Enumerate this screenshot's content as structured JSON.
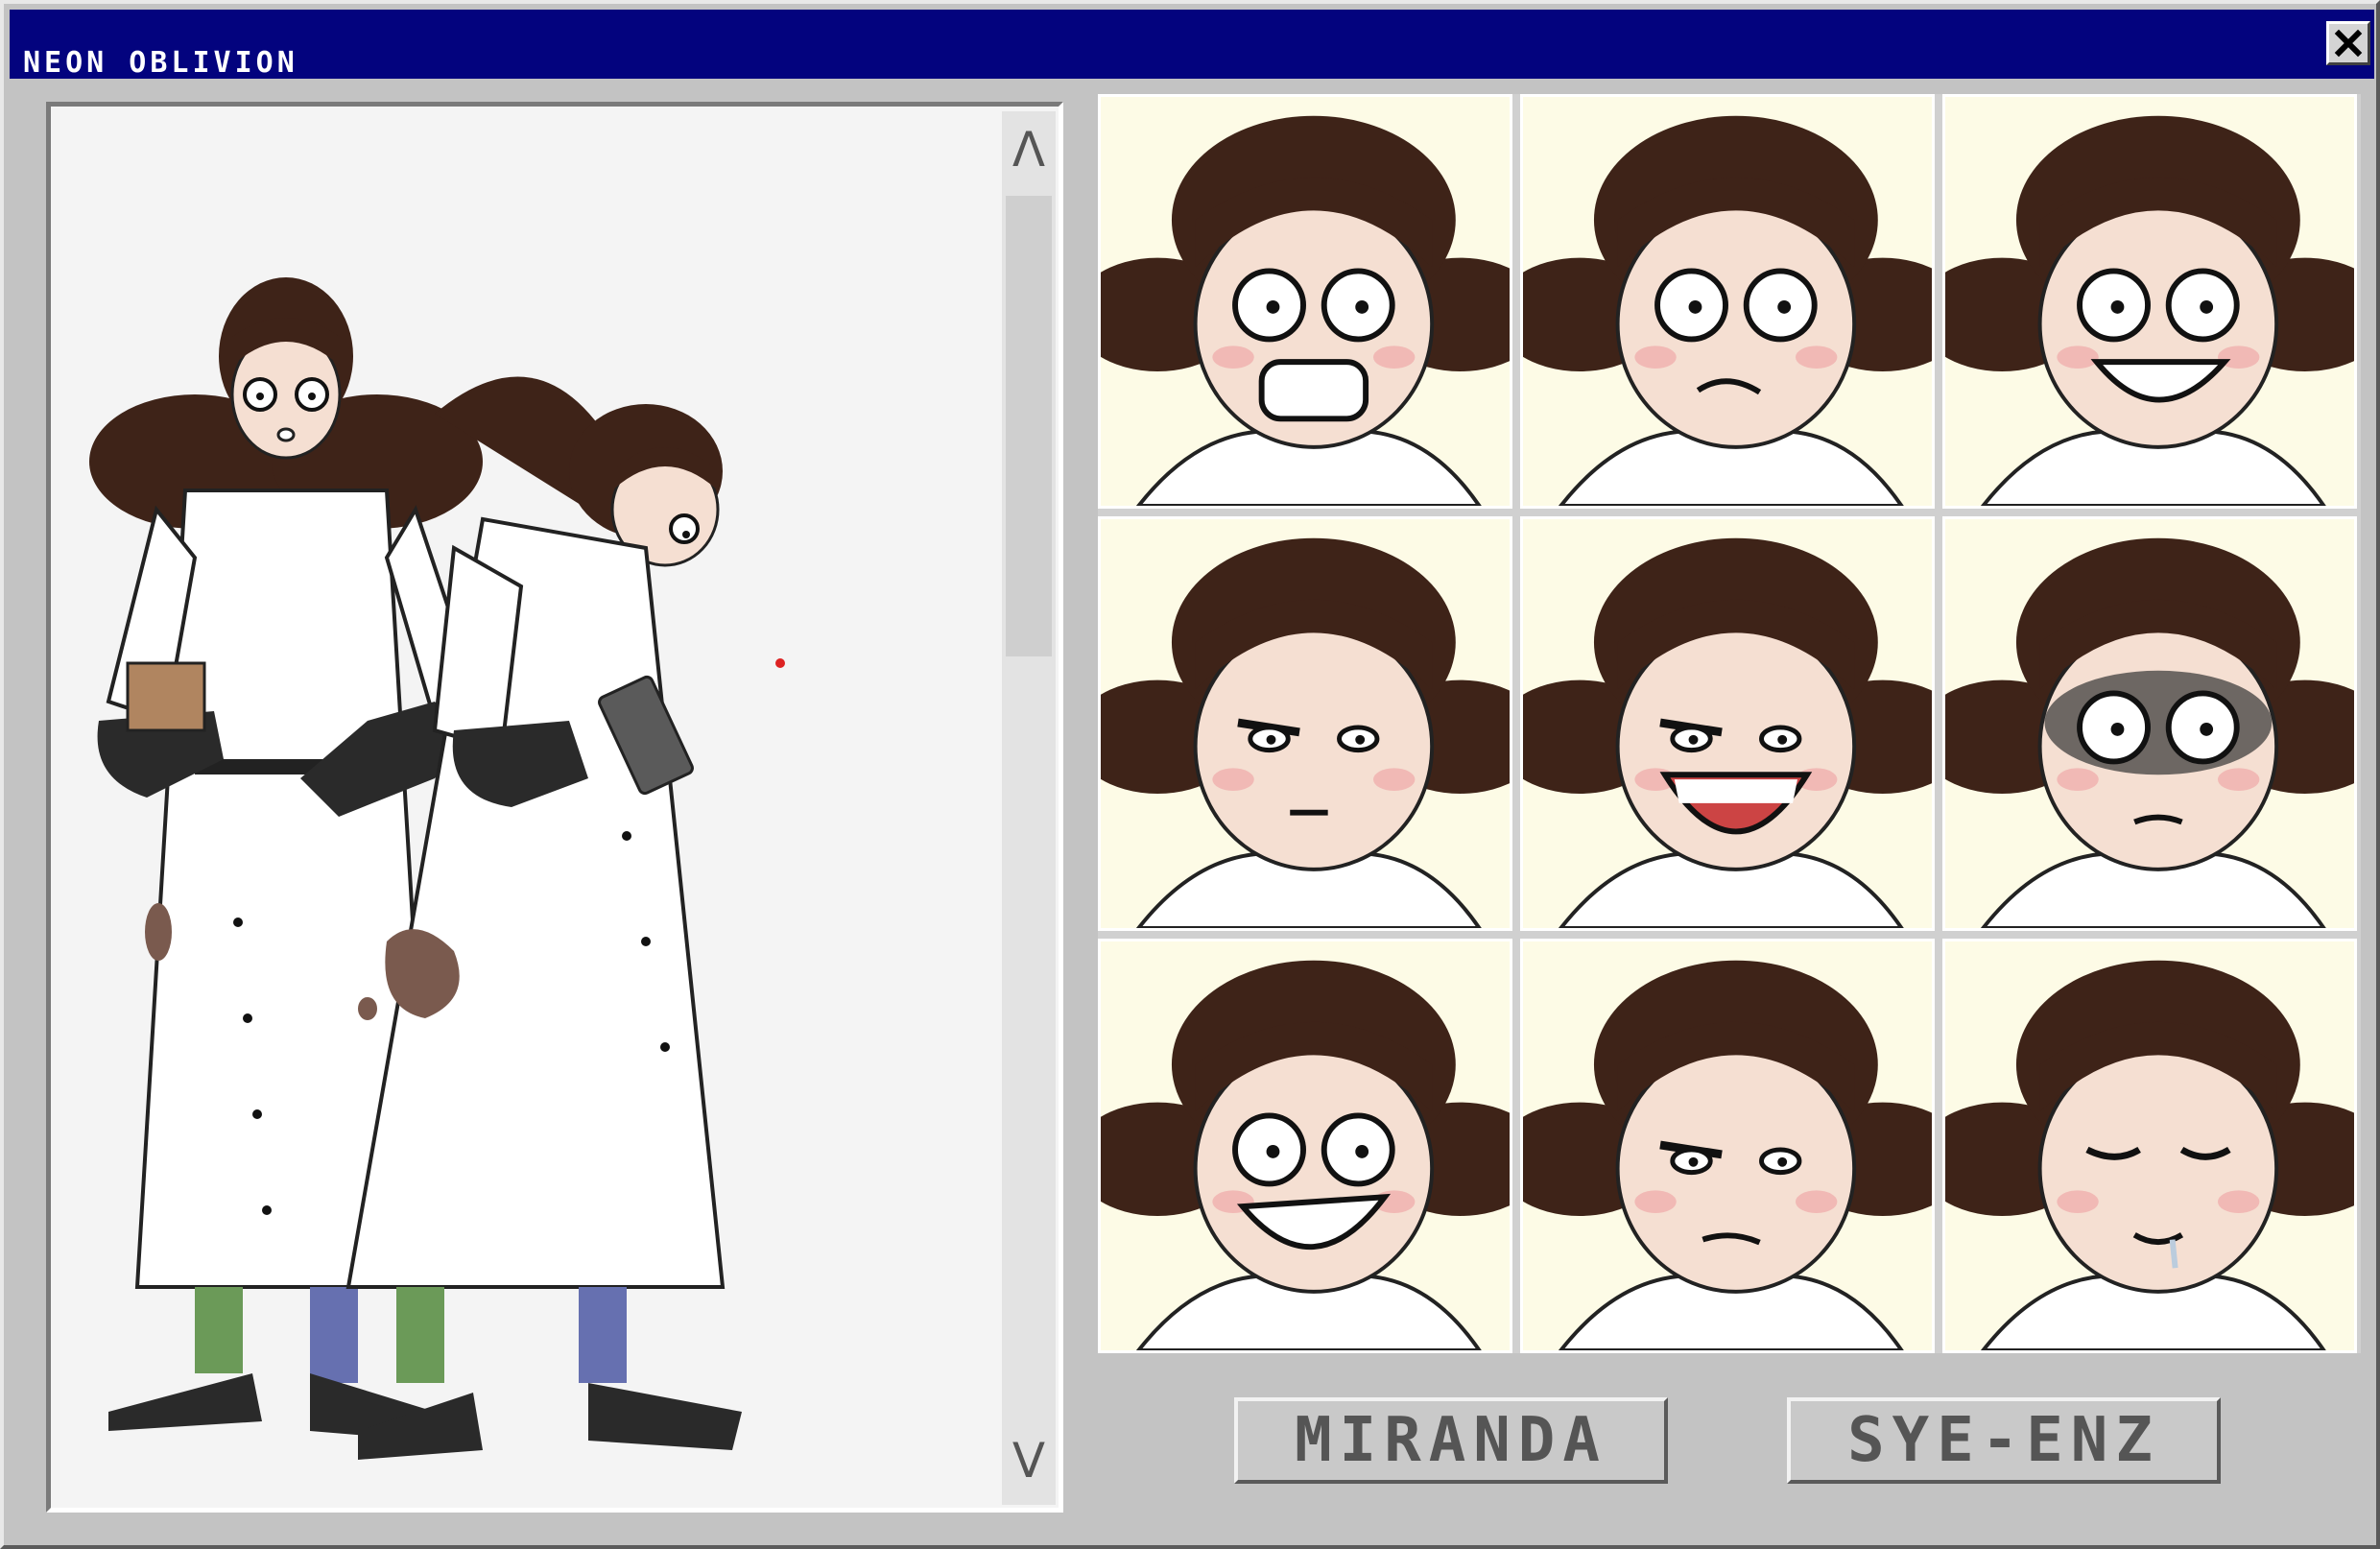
{
  "window": {
    "title": "NEON OBLIVION",
    "close_icon": "close-icon"
  },
  "scrollbar": {
    "up_arrow": "Λ",
    "down_arrow": "V"
  },
  "expressions": [
    "shocked",
    "worried",
    "nervous-grin",
    "suspicious",
    "laughing",
    "gloomy",
    "frantic-grin",
    "unimpressed",
    "exhausted"
  ],
  "buttons": {
    "left_label": "MIRANDA",
    "right_label": "SYE-ENZ"
  },
  "colors": {
    "titlebar": "#03037e",
    "window": "#c3c3c3",
    "cell_bg": "#fdfbe6",
    "hair": "#3e2318",
    "skin": "#f5dfd2",
    "coat": "#ffffff",
    "glove": "#2a2a2a",
    "stain": "#7a5a4e",
    "sock_green": "#6b9a58",
    "sock_blue": "#6670b0"
  }
}
